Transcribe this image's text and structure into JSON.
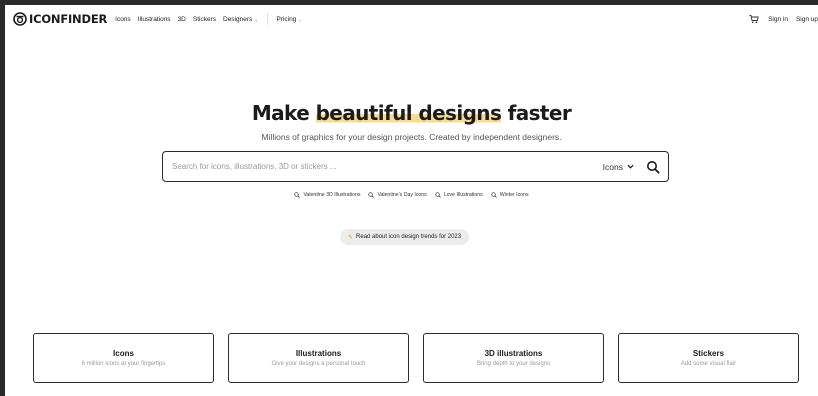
{
  "header": {
    "brand": "ICONFINDER",
    "logo_icon": "iconfinder-logo-icon",
    "nav": [
      {
        "label": "Icons",
        "dropdown": false
      },
      {
        "label": "Illustrations",
        "dropdown": false
      },
      {
        "label": "3D",
        "dropdown": false
      },
      {
        "label": "Stickers",
        "dropdown": false
      },
      {
        "label": "Designers",
        "dropdown": true
      }
    ],
    "pricing": {
      "label": "Pricing",
      "dropdown": true
    },
    "cart_icon": "cart-icon",
    "sign_in": "Sign in",
    "sign_up": "Sign up"
  },
  "hero": {
    "title_pre": "Make ",
    "title_highlight": "beautiful designs",
    "title_post": " faster",
    "subtitle": "Millions of graphics for your design projects. Created by independent designers.",
    "highlight_color": "#f7dc8f"
  },
  "search": {
    "placeholder": "Search for icons, illustrations, 3D or stickers ...",
    "value": "",
    "type_selected": "Icons",
    "search_icon": "search-icon"
  },
  "suggestions": [
    "Valentine 3D Illustrations",
    "Valentine's Day Icons",
    "Love Illustrations",
    "Winter Icons"
  ],
  "trend_link": {
    "label": "Read about icon design trends for 2023",
    "icon": "pencil-icon"
  },
  "categories": [
    {
      "title": "Icons",
      "subtitle": "6 million icons at your fingertips"
    },
    {
      "title": "Illustrations",
      "subtitle": "Give your designs a personal touch"
    },
    {
      "title": "3D illustrations",
      "subtitle": "Bring depth to your designs"
    },
    {
      "title": "Stickers",
      "subtitle": "Add some visual flair"
    }
  ]
}
